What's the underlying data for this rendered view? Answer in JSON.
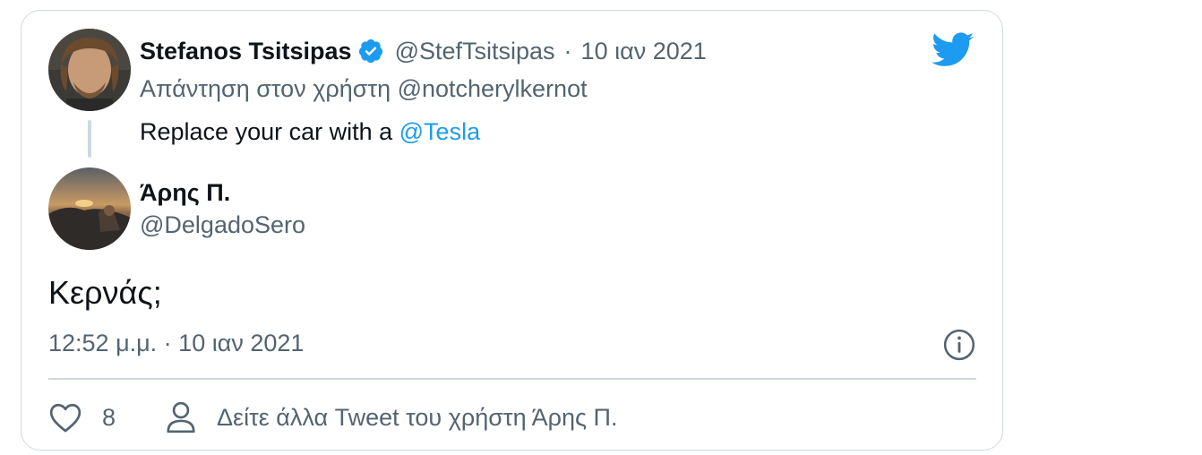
{
  "parent_tweet": {
    "author_name": "Stefanos Tsitsipas",
    "author_handle": "@StefTsitsipas",
    "separator": "·",
    "date": "10 ιαν 2021",
    "reply_to_label": "Απάντηση στον χρήστη @notcherylkernot",
    "text_prefix": "Replace your car with a ",
    "text_mention": "@Tesla",
    "verified_icon": "verified-badge-icon"
  },
  "main_tweet": {
    "author_name": "Άρης Π.",
    "author_handle": "@DelgadoSero",
    "text": "Κερνάς;",
    "timestamp": "12:52 μ.μ. · 10 ιαν 2021"
  },
  "actions": {
    "like_count": "8",
    "more_tweets_label": "Δείτε άλλα Tweet του χρήστη Άρης Π."
  },
  "icons": {
    "brand": "twitter-bird-icon",
    "info": "info-icon",
    "like": "heart-icon",
    "person": "person-icon"
  },
  "colors": {
    "accent": "#1d9bf0",
    "muted": "#536471",
    "border": "#cfd9de",
    "text": "#0f1419"
  }
}
